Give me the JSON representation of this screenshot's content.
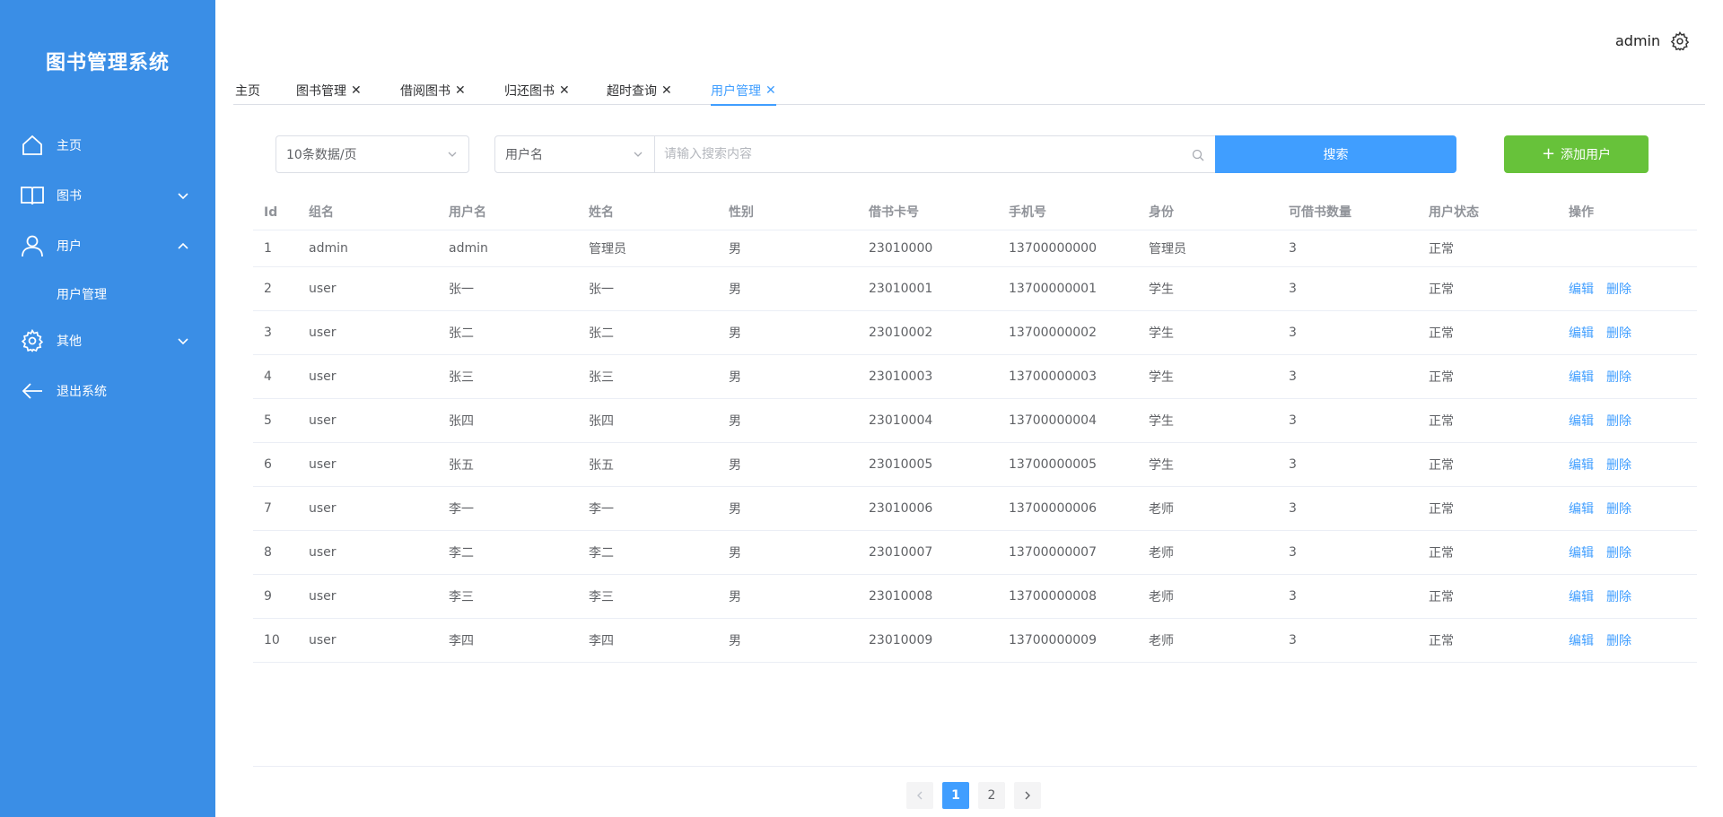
{
  "sidebar": {
    "title": "图书管理系统",
    "bg": "#3a8ee6",
    "items": [
      {
        "label": "主页",
        "icon": "home-icon"
      },
      {
        "label": "图书",
        "icon": "book-icon"
      },
      {
        "label": "用户",
        "icon": "user-icon"
      },
      {
        "label": "用户管理"
      },
      {
        "label": "其他",
        "icon": "gear-icon"
      },
      {
        "label": "退出系统",
        "icon": "arrow-left-icon"
      }
    ]
  },
  "header": {
    "username": "admin"
  },
  "tabs": [
    {
      "label": "主页"
    },
    {
      "label": "图书管理"
    },
    {
      "label": "借阅图书"
    },
    {
      "label": "归还图书"
    },
    {
      "label": "超时查询"
    },
    {
      "label": "用户管理"
    }
  ],
  "toolbar": {
    "page_size": "10条数据/页",
    "search_field": "用户名",
    "search_placeholder": "请输入搜索内容",
    "search_label": "搜索",
    "add_label": "添加用户"
  },
  "colors": {
    "primary": "#409eff",
    "success": "#67c23a"
  },
  "table": {
    "columns": [
      "Id",
      "组名",
      "用户名",
      "姓名",
      "性别",
      "借书卡号",
      "手机号",
      "身份",
      "可借书数量",
      "用户状态",
      "操作"
    ],
    "edit_label": "编辑",
    "delete_label": "删除",
    "rows": [
      [
        "1",
        "admin",
        "admin",
        "管理员",
        "男",
        "23010000",
        "13700000000",
        "管理员",
        "3",
        "正常"
      ],
      [
        "2",
        "user",
        "张一",
        "张一",
        "男",
        "23010001",
        "13700000001",
        "学生",
        "3",
        "正常"
      ],
      [
        "3",
        "user",
        "张二",
        "张二",
        "男",
        "23010002",
        "13700000002",
        "学生",
        "3",
        "正常"
      ],
      [
        "4",
        "user",
        "张三",
        "张三",
        "男",
        "23010003",
        "13700000003",
        "学生",
        "3",
        "正常"
      ],
      [
        "5",
        "user",
        "张四",
        "张四",
        "男",
        "23010004",
        "13700000004",
        "学生",
        "3",
        "正常"
      ],
      [
        "6",
        "user",
        "张五",
        "张五",
        "男",
        "23010005",
        "13700000005",
        "学生",
        "3",
        "正常"
      ],
      [
        "7",
        "user",
        "李一",
        "李一",
        "男",
        "23010006",
        "13700000006",
        "老师",
        "3",
        "正常"
      ],
      [
        "8",
        "user",
        "李二",
        "李二",
        "男",
        "23010007",
        "13700000007",
        "老师",
        "3",
        "正常"
      ],
      [
        "9",
        "user",
        "李三",
        "李三",
        "男",
        "23010008",
        "13700000008",
        "老师",
        "3",
        "正常"
      ],
      [
        "10",
        "user",
        "李四",
        "李四",
        "男",
        "23010009",
        "13700000009",
        "老师",
        "3",
        "正常"
      ]
    ]
  },
  "pagination": {
    "pages": [
      "1",
      "2"
    ],
    "current": "1"
  }
}
